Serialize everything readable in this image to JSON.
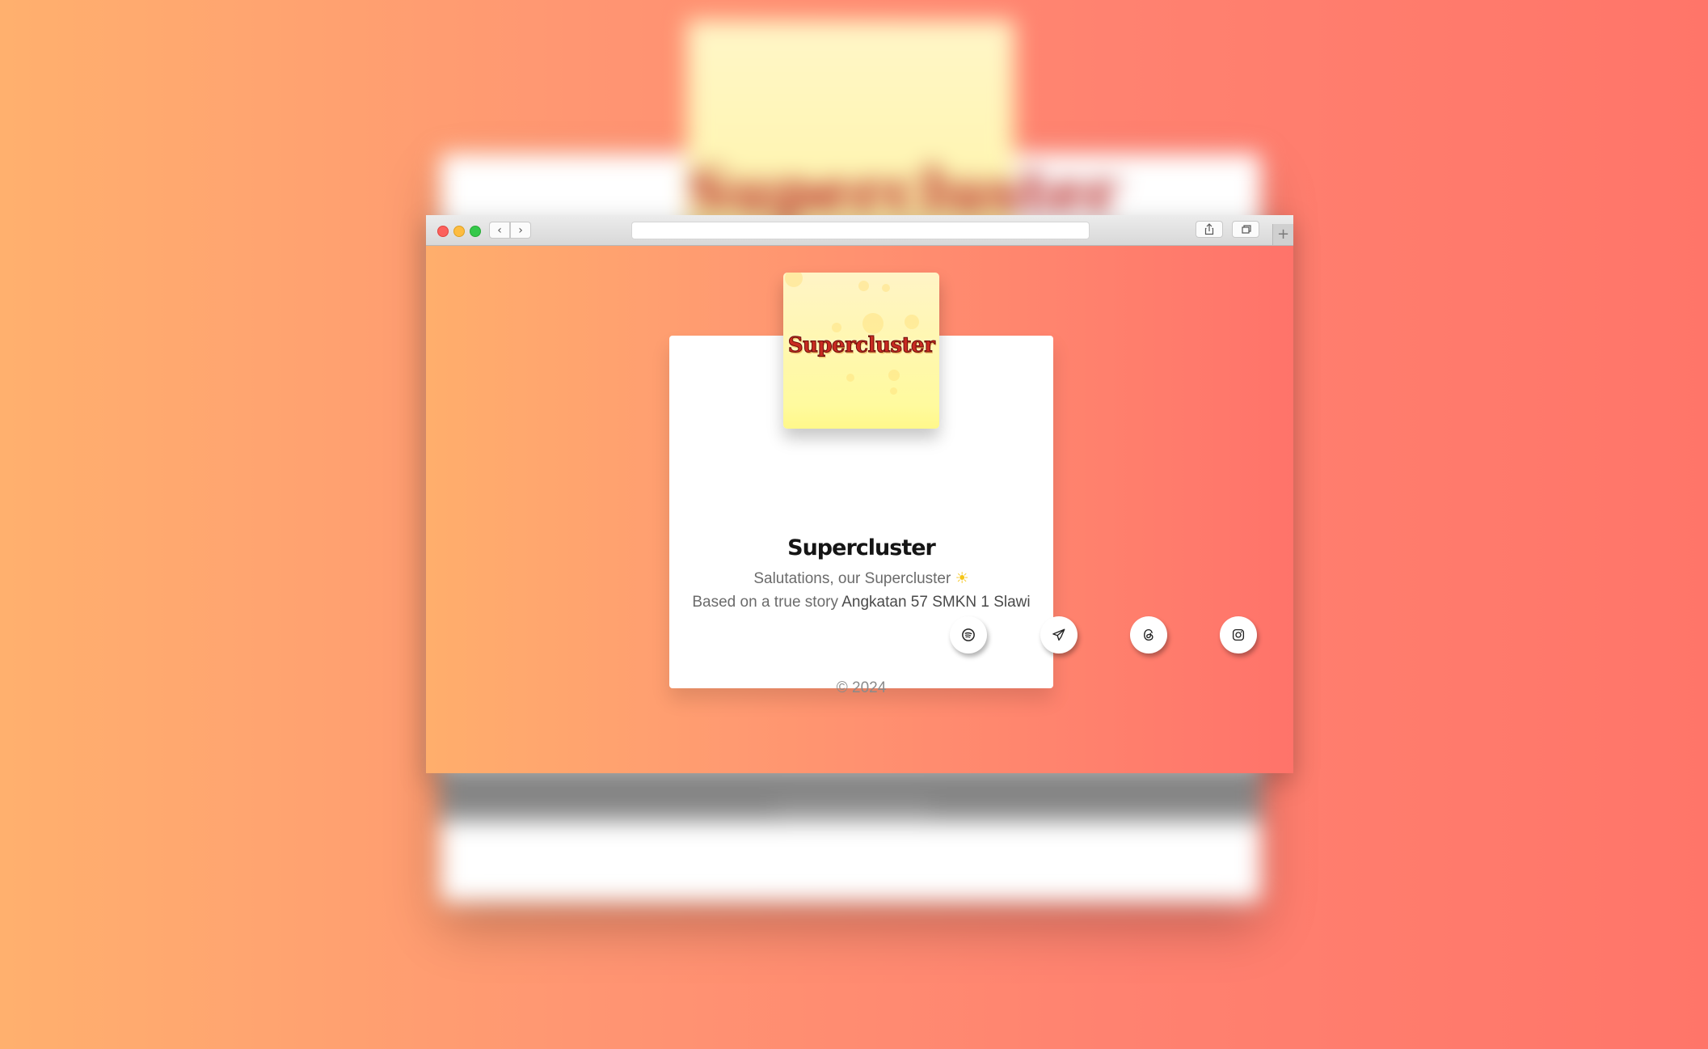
{
  "background_preview": {
    "cover_text": "Supercluster"
  },
  "browser": {
    "url": "",
    "buttons": {
      "back_glyph": "‹",
      "forward_glyph": "›",
      "new_tab_glyph": "+"
    },
    "icons": [
      "close-icon",
      "minimize-icon",
      "maximize-icon",
      "share-icon",
      "tabs-icon",
      "plus-icon"
    ]
  },
  "profile": {
    "cover_logo_text": "Supercluster",
    "title": "Supercluster",
    "tagline_line1": "Salutations, our Supercluster",
    "tagline_emoji": "☀",
    "tagline_line2_prefix": "Based on a true story",
    "tagline_line2_highlight": "Angkatan 57 SMKN 1 Slawi",
    "social_links": [
      {
        "name": "spotify",
        "icon": "spotify-icon"
      },
      {
        "name": "telegram",
        "icon": "telegram-icon"
      },
      {
        "name": "threads",
        "icon": "threads-icon"
      },
      {
        "name": "instagram",
        "icon": "instagram-icon"
      }
    ],
    "copyright": "© 2024"
  },
  "colors": {
    "gradient_start": "#ffb06e",
    "gradient_end": "#ff7569",
    "cover_logo": "#c92b22",
    "cover_bg": "#fffa9e"
  }
}
